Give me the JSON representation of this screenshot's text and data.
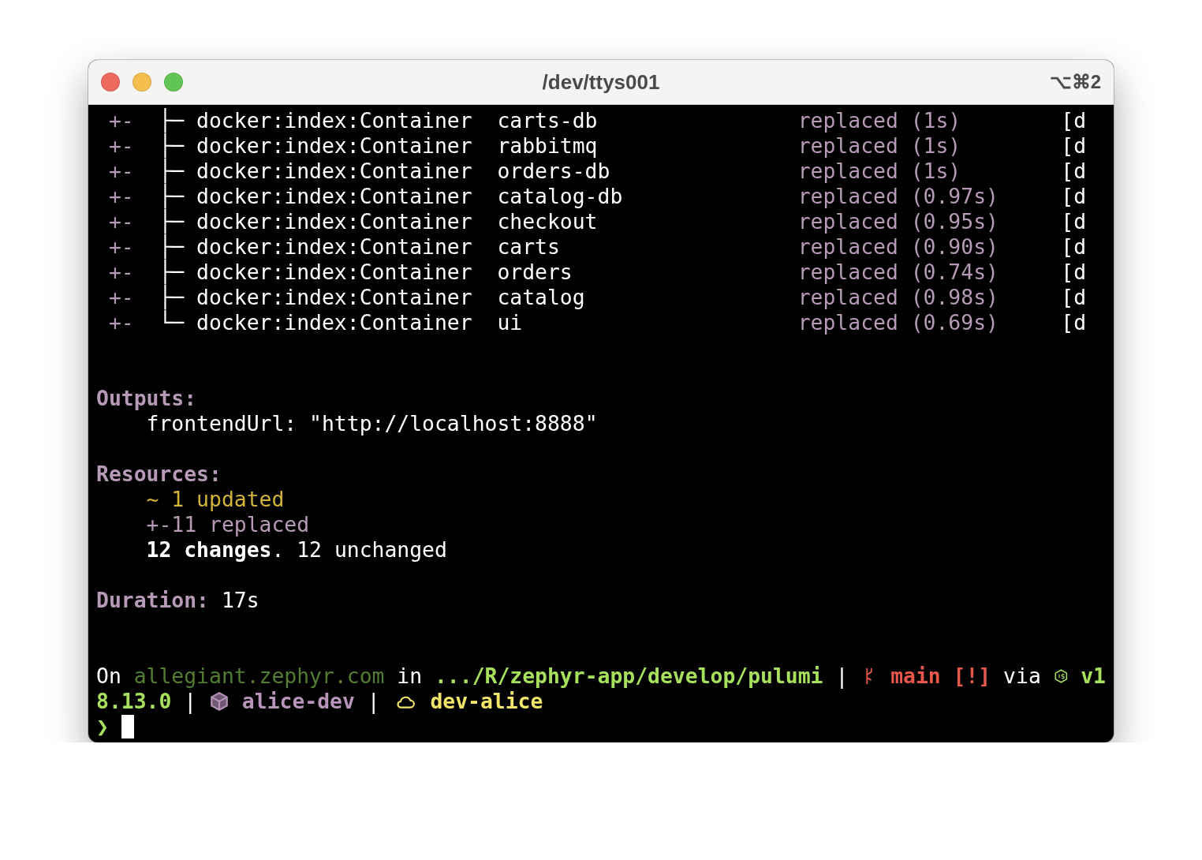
{
  "window": {
    "title": "/dev/ttys001",
    "shortcut": "⌥⌘2"
  },
  "resource_rows": [
    {
      "op": "+-",
      "tree": "├─",
      "type": "docker:index:Container",
      "name": "carts-db",
      "status": "replaced (1s)",
      "info": "[d"
    },
    {
      "op": "+-",
      "tree": "├─",
      "type": "docker:index:Container",
      "name": "rabbitmq",
      "status": "replaced (1s)",
      "info": "[d"
    },
    {
      "op": "+-",
      "tree": "├─",
      "type": "docker:index:Container",
      "name": "orders-db",
      "status": "replaced (1s)",
      "info": "[d"
    },
    {
      "op": "+-",
      "tree": "├─",
      "type": "docker:index:Container",
      "name": "catalog-db",
      "status": "replaced (0.97s)",
      "info": "[d"
    },
    {
      "op": "+-",
      "tree": "├─",
      "type": "docker:index:Container",
      "name": "checkout",
      "status": "replaced (0.95s)",
      "info": "[d"
    },
    {
      "op": "+-",
      "tree": "├─",
      "type": "docker:index:Container",
      "name": "carts",
      "status": "replaced (0.90s)",
      "info": "[d"
    },
    {
      "op": "+-",
      "tree": "├─",
      "type": "docker:index:Container",
      "name": "orders",
      "status": "replaced (0.74s)",
      "info": "[d"
    },
    {
      "op": "+-",
      "tree": "├─",
      "type": "docker:index:Container",
      "name": "catalog",
      "status": "replaced (0.98s)",
      "info": "[d"
    },
    {
      "op": "+-",
      "tree": "└─",
      "type": "docker:index:Container",
      "name": "ui",
      "status": "replaced (0.69s)",
      "info": "[d"
    }
  ],
  "outputs": {
    "heading": "Outputs:",
    "lines": [
      "frontendUrl: \"http://localhost:8888\""
    ]
  },
  "resources": {
    "heading": "Resources:",
    "lines": [
      {
        "kind": "updated",
        "text": "~ 1 updated"
      },
      {
        "kind": "replaced",
        "text": "+-11 replaced"
      },
      {
        "kind": "total",
        "text": "**12 changes**. 12 unchanged"
      }
    ]
  },
  "duration": {
    "heading": "Duration:",
    "value": "17s"
  },
  "prompt_lines": [
    [
      {
        "kind": "text",
        "text": "On",
        "color": "#ffffff",
        "bold": false
      },
      {
        "kind": "text",
        "text": "allegiant.zephyr.com",
        "color": "#527d32",
        "bold": false
      },
      {
        "kind": "text",
        "text": "in",
        "color": "#ffffff",
        "bold": false
      },
      {
        "kind": "text",
        "text": ".../R/zephyr-app/develop/pulumi",
        "color": "#a6e05c",
        "bold": true
      },
      {
        "kind": "text",
        "text": "|",
        "color": "#ffffff",
        "bold": false
      },
      {
        "kind": "git",
        "color": "#e8584a"
      },
      {
        "kind": "text",
        "text": "main",
        "color": "#e8584a",
        "bold": true
      },
      {
        "kind": "text",
        "text": "[!]",
        "color": "#e8584a",
        "bold": true
      },
      {
        "kind": "text",
        "text": "via",
        "color": "#ffffff",
        "bold": false
      },
      {
        "kind": "node",
        "color": "#a6e05c"
      },
      {
        "kind": "text",
        "text": "v1",
        "color": "#a6e05c",
        "bold": true
      }
    ],
    [
      {
        "kind": "text",
        "text": "8.13.0",
        "color": "#a6e05c",
        "bold": true
      },
      {
        "kind": "text",
        "text": "|",
        "color": "#ffffff",
        "bold": false
      },
      {
        "kind": "cube",
        "color": "#b894ba"
      },
      {
        "kind": "text",
        "text": "alice-dev",
        "color": "#b894ba",
        "bold": true
      },
      {
        "kind": "text",
        "text": "|",
        "color": "#ffffff",
        "bold": false
      },
      {
        "kind": "cloud",
        "color": "#f3e46a"
      },
      {
        "kind": "text",
        "text": "dev-alice",
        "color": "#f3e46a",
        "bold": true
      }
    ]
  ],
  "input_line": {
    "symbol": "❯"
  }
}
